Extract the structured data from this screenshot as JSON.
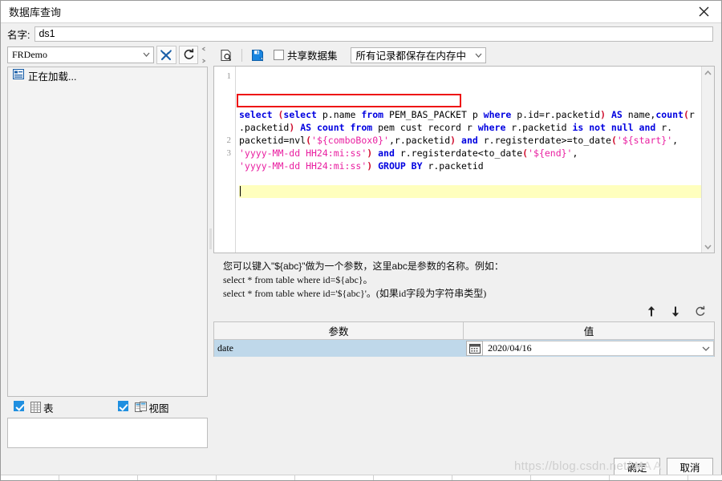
{
  "window": {
    "title": "数据库查询",
    "close_icon": "close-icon"
  },
  "name_row": {
    "label": "名字:",
    "value": "ds1"
  },
  "left_panel": {
    "db_select": {
      "value": "FRDemo",
      "arrow_icon": "chevron-down-icon"
    },
    "buttons": [
      {
        "name": "database-config-button",
        "icon": "wrench-screwdriver-icon"
      },
      {
        "name": "refresh-connection-button",
        "icon": "refresh-icon"
      }
    ],
    "tree": {
      "items": [
        {
          "label": "正在加载...",
          "icon": "loading-table-icon"
        }
      ]
    },
    "checkboxes": [
      {
        "label": "表",
        "checked": true,
        "icon": "table-icon"
      },
      {
        "label": "视图",
        "checked": true,
        "icon": "view-icon"
      }
    ]
  },
  "sql_toolbar": {
    "preview_icon": "preview-magnifier-icon",
    "save_icon": "save-floppy-icon",
    "share_dataset": {
      "label": "共享数据集",
      "checked": false
    },
    "memory_mode": {
      "value": "所有记录都保存在内存中",
      "arrow_icon": "chevron-down-icon"
    }
  },
  "editor": {
    "line_numbers": [
      "1",
      "2",
      "3"
    ],
    "scroll_up_icon": "chevron-up-icon",
    "scroll_down_icon": "chevron-down-icon",
    "highlighted_line_index": 2,
    "sql_text": "select (select p.name from PEM_BAS_PACKET p where p.id=r.packetid) AS name,count(r.packetid) AS count from pem cust record r where r.packetid is not null and r.packetid=nvl('${comboBox0}',r.packetid) and r.registerdate>=to_date('${start}', 'yyyy-MM-dd HH24:mi:ss') and r.registerdate<to_date('${end}', 'yyyy-MM-dd HH24:mi:ss') GROUP BY r.packetid",
    "lines": [
      [
        {
          "t": "select ",
          "c": "kw"
        },
        {
          "t": "(",
          "c": "fn"
        },
        {
          "t": "select ",
          "c": "kw"
        },
        {
          "t": "p.name ",
          "c": "plain"
        },
        {
          "t": "from ",
          "c": "kw"
        },
        {
          "t": "PEM_BAS_PACKET p ",
          "c": "plain"
        },
        {
          "t": "where ",
          "c": "kw"
        },
        {
          "t": "p.id=r.packetid",
          "c": "plain"
        },
        {
          "t": ")",
          "c": "fn"
        },
        {
          "t": " ",
          "c": "plain"
        },
        {
          "t": "AS ",
          "c": "kw"
        },
        {
          "t": "name,",
          "c": "plain"
        },
        {
          "t": "count",
          "c": "kw"
        },
        {
          "t": "(",
          "c": "fn"
        },
        {
          "t": "r",
          "c": "plain"
        }
      ],
      [
        {
          "t": ".packetid",
          "c": "plain"
        },
        {
          "t": ")",
          "c": "fn"
        },
        {
          "t": " ",
          "c": "plain"
        },
        {
          "t": "AS count ",
          "c": "kw"
        },
        {
          "t": "from ",
          "c": "kw"
        },
        {
          "t": "pem cust record r ",
          "c": "plain"
        },
        {
          "t": "where ",
          "c": "kw"
        },
        {
          "t": "r.packetid ",
          "c": "plain"
        },
        {
          "t": "is not null and ",
          "c": "kw"
        },
        {
          "t": "r.",
          "c": "plain"
        }
      ],
      [
        {
          "t": "packetid=",
          "c": "plain"
        },
        {
          "t": "nvl",
          "c": "plain"
        },
        {
          "t": "(",
          "c": "fn"
        },
        {
          "t": "'${comboBox0}'",
          "c": "str"
        },
        {
          "t": ",r.packetid",
          "c": "plain"
        },
        {
          "t": ")",
          "c": "fn"
        },
        {
          "t": " ",
          "c": "plain"
        },
        {
          "t": "and ",
          "c": "kw"
        },
        {
          "t": "r.registerdate>=to_date",
          "c": "plain"
        },
        {
          "t": "(",
          "c": "fn"
        },
        {
          "t": "'${start}'",
          "c": "str"
        },
        {
          "t": ",",
          "c": "plain"
        }
      ],
      [
        {
          "t": "'yyyy-MM-dd HH24:mi:ss'",
          "c": "str"
        },
        {
          "t": ")",
          "c": "fn"
        },
        {
          "t": " ",
          "c": "plain"
        },
        {
          "t": "and ",
          "c": "kw"
        },
        {
          "t": "r.registerdate<to_date",
          "c": "plain"
        },
        {
          "t": "(",
          "c": "fn"
        },
        {
          "t": "'${end}'",
          "c": "str"
        },
        {
          "t": ",",
          "c": "plain"
        }
      ],
      [
        {
          "t": "'yyyy-MM-dd HH24:mi:ss'",
          "c": "str"
        },
        {
          "t": ")",
          "c": "fn"
        },
        {
          "t": " ",
          "c": "plain"
        },
        {
          "t": "GROUP BY ",
          "c": "kw"
        },
        {
          "t": "r.packetid",
          "c": "plain"
        }
      ]
    ],
    "annotation": {
      "name": "red-highlight-box",
      "color": "#ee1111"
    }
  },
  "help": {
    "line1": "您可以键入\"${abc}\"做为一个参数，这里abc是参数的名称。例如：",
    "line2": "select * from table where id=${abc}。",
    "line3": "select * from table where id='${abc}'。(如果id字段为字符串类型)"
  },
  "param_tools": [
    {
      "name": "move-up-button",
      "icon": "arrow-up-icon"
    },
    {
      "name": "move-down-button",
      "icon": "arrow-down-icon"
    },
    {
      "name": "refresh-params-button",
      "icon": "refresh-icon"
    }
  ],
  "param_table": {
    "columns": [
      "参数",
      "值"
    ],
    "rows": [
      {
        "param": "date",
        "value": "2020/04/16",
        "calendar_icon": "calendar-icon",
        "arrow_icon": "chevron-down-icon"
      }
    ]
  },
  "footer": {
    "ok_label": "确定",
    "cancel_label": "取消",
    "watermark": "https://blog.csdn.net/W",
    "watermark2": "HA     A"
  },
  "colors": {
    "accent": "#1f8fe0",
    "selection": "#bfd8ea",
    "highlight_line": "#ffffbe",
    "annotation": "#ee1111",
    "keyword": "#0000e0",
    "string": "#e91ea0",
    "paren": "#d01030"
  }
}
